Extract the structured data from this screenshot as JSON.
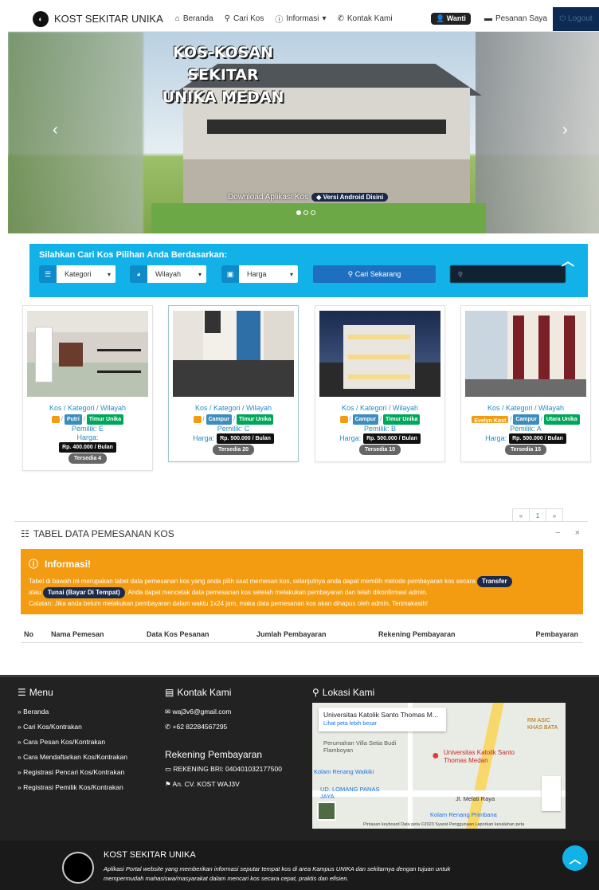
{
  "nav": {
    "brand": "KOST SEKITAR UNIKA",
    "items": [
      "Beranda",
      "Cari Kos",
      "Informasi",
      "Kontak Kami"
    ],
    "user": "Wanti",
    "orders": "Pesanan Saya",
    "logout": "Logout"
  },
  "hero": {
    "title_line1": "KOS-KOSAN SEKITAR",
    "title_line2": "UNIKA MEDAN",
    "caption": "Download Aplikasi Kos",
    "badge": "Versi Android Disini"
  },
  "search": {
    "title": "Silahkan Cari Kos Pilihan Anda Berdasarkan:",
    "kategori": "Kategori",
    "wilayah": "Wilayah",
    "harga": "Harga",
    "button": "Cari Sekarang"
  },
  "cards": [
    {
      "meta": "Kos / Kategori / Wilayah",
      "name_tag": "",
      "tag1": "Putri",
      "tag2": "Timur Unika",
      "owner": "Pemilik: E",
      "harga_label": "Harga:",
      "price": "Rp. 400.000 / Bulan",
      "avail": "Tersedia 4"
    },
    {
      "meta": "Kos / Kategori / Wilayah",
      "name_tag": "",
      "tag1": "Campur",
      "tag2": "Timur Unika",
      "owner": "Pemilik: C",
      "harga_label": "Harga:",
      "price": "Rp. 500.000 / Bulan",
      "avail": "Tersedia 20"
    },
    {
      "meta": "Kos / Kategori / Wilayah",
      "name_tag": "",
      "tag1": "Campur",
      "tag2": "Timur Unika",
      "owner": "Pemilik: B",
      "harga_label": "Harga:",
      "price": "Rp. 500.000 / Bulan",
      "avail": "Tersedia 10"
    },
    {
      "meta": "Kos / Kategori / Wilayah",
      "name_tag": "Evelyn Kost",
      "tag1": "Campur",
      "tag2": "Utara Unika",
      "owner": "Pemilik: A",
      "harga_label": "Harga:",
      "price": "Rp. 500.000 / Bulan",
      "avail": "Tersedia 15"
    }
  ],
  "pager": [
    "«",
    "1",
    "»"
  ],
  "table": {
    "title": "TABEL DATA PEMESANAN KOS",
    "alert_title": "Informasi!",
    "alert_p1": "Tabel di bawah ini merupakan tabel data pemesanan kos yang anda pilih saat memesan kos, selanjutnya anda dapat memilih metode pembayaran kos secara",
    "pill1": "Transfer",
    "atau": "atau",
    "pill2": "Tunai (Bayar Di Tempat)",
    "alert_p2": ". Anda dapat mencetak data pemesanan kos setelah melakukan pembayaran dan telah dikonfirmasi admin.",
    "alert_p3": "Catatan: Jika anda belum melakukan pembayaran dalam waktu 1x24 jam, maka data pemesanan kos akan dihapus oleh admin. Terimakasih!",
    "headers": [
      "No",
      "Nama Pemesan",
      "Data Kos Pesanan",
      "Jumlah Pembayaran",
      "Rekening Pembayaran",
      "Pembayaran"
    ]
  },
  "footer": {
    "menu_title": "Menu",
    "menu": [
      "Beranda",
      "Cari Kos/Kontrakan",
      "Cara Pesan Kos/Kontrakan",
      "Cara Mendaftarkan Kos/Kontrakan",
      "Registrasi Pencari Kos/Kontrakan",
      "Registrasi Pemilik Kos/Kontrakan"
    ],
    "kontak_title": "Kontak Kami",
    "email": "waj3v6@gmail.com",
    "phone": "+62 82284567295",
    "rek_title": "Rekening Pembayaran",
    "rek": "REKENING BRI: 040401032177500",
    "an": "An. CV. KOST WAJ3V",
    "lokasi_title": "Lokasi Kami",
    "map_place": "Universitas Katolik Santo Thomas M...",
    "map_link": "Lihat peta lebih besar",
    "map_pin": "Universitas Katolik Santo Thomas Medan",
    "map_l1": "Perumahan Villa Setia Budi Flamboyan",
    "map_l2": "Kolam Renang Waikiki",
    "map_l3": "UD. LOMANG PANAS JAYA",
    "map_l4": "Jl. Melati Raya",
    "map_l5": "Kolam Renang Primbana",
    "map_l6": "RM ASIC KHAS BATA",
    "map_footer": "Pintasan keyboard   Data peta ©2023   Syarat Penggunaan   Laporkan kesalahan peta",
    "site_title": "KOST SEKITAR UNIKA",
    "site_desc1": "Aplikasi Portal website yang memberikan informasi seputar tempat kos di area Kampus UNIKA dan sekitarnya dengan tujuan untuk",
    "site_desc2": "mempermudah mahasiswa/masyarakat dalam mencari kos secara cepat, praktis dan efisien."
  }
}
